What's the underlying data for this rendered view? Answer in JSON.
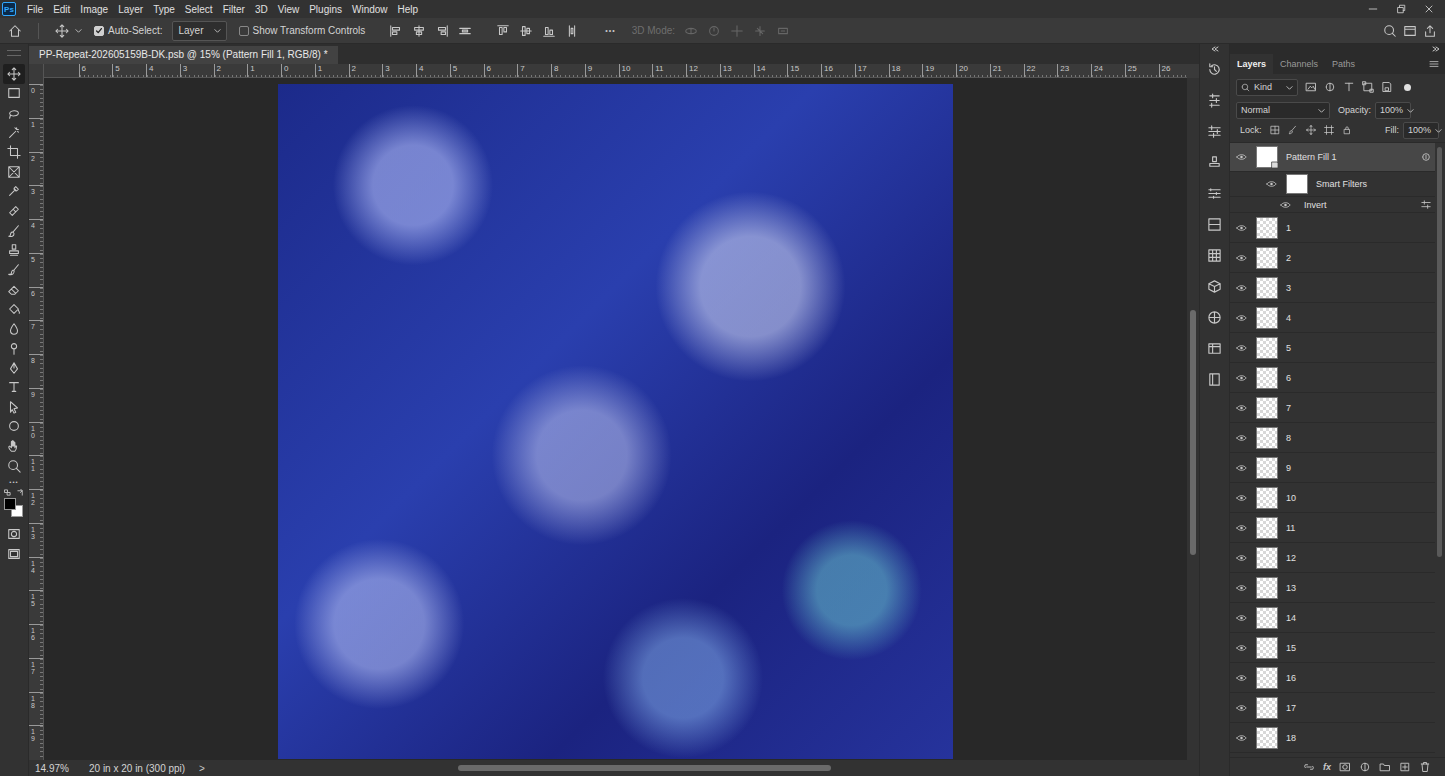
{
  "app": {
    "logo": "Ps"
  },
  "menu": [
    "File",
    "Edit",
    "Image",
    "Layer",
    "Type",
    "Select",
    "Filter",
    "3D",
    "View",
    "Plugins",
    "Window",
    "Help"
  ],
  "options_bar": {
    "auto_select": {
      "label": "Auto-Select:",
      "checked": true
    },
    "auto_select_target": "Layer",
    "show_transform_controls": {
      "label": "Show Transform Controls",
      "checked": false
    },
    "more": "•••",
    "mode_3d": {
      "label": "3D Mode:",
      "disabled": true
    }
  },
  "document": {
    "title": "PP-Repeat-202605159B-DK.psb @ 15% (Pattern Fill 1, RGB/8) *"
  },
  "rulers": {
    "horizontal": [
      "6",
      "5",
      "4",
      "3",
      "2",
      "1",
      "0",
      "1",
      "2",
      "3",
      "4",
      "5",
      "6",
      "7",
      "8",
      "9",
      "10",
      "11",
      "12",
      "13",
      "14",
      "15",
      "16",
      "17",
      "18",
      "19",
      "20",
      "21",
      "22",
      "23",
      "24",
      "25",
      "26"
    ],
    "vertical": [
      "0",
      "1",
      "2",
      "3",
      "4",
      "5",
      "6",
      "7",
      "8",
      "9",
      "10",
      "11",
      "12",
      "13",
      "14",
      "15",
      "16",
      "17",
      "18",
      "19"
    ]
  },
  "toolbar": {
    "tools": [
      {
        "selected": true
      },
      {
        "selected": false
      },
      {
        "selected": false
      },
      {
        "selected": false
      },
      {
        "selected": false
      },
      {
        "selected": false
      },
      {
        "selected": false
      },
      {
        "selected": false
      },
      {
        "selected": false
      },
      {
        "selected": false
      },
      {
        "selected": false
      },
      {
        "selected": false
      },
      {
        "selected": false
      },
      {
        "selected": false
      },
      {
        "selected": false
      },
      {
        "selected": false
      },
      {
        "selected": false
      },
      {
        "selected": false
      },
      {
        "selected": false
      },
      {
        "selected": false
      },
      {
        "selected": false
      }
    ],
    "more": "•••",
    "swatches": [
      {
        "role": "foreground",
        "color": "#000000"
      },
      {
        "role": "background",
        "color": "#ffffff"
      }
    ]
  },
  "status_bar": {
    "zoom": "14.97%",
    "info": "20 in x 20 in (300 ppi)",
    "arrow": ">"
  },
  "layers_panel": {
    "tabs": [
      {
        "label": "Layers",
        "selected": true
      },
      {
        "label": "Channels",
        "selected": false
      },
      {
        "label": "Paths",
        "selected": false
      }
    ],
    "filter": "Kind",
    "blend_mode": "Normal",
    "opacity_label": "Opacity:",
    "opacity": "100%",
    "lock_label": "Lock:",
    "fill_label": "Fill:",
    "fill": "100%",
    "layers": [
      {
        "name": "Pattern Fill 1",
        "kind": "smart-object",
        "visible": true,
        "selected": true
      },
      {
        "name": "Smart Filters",
        "kind": "smart-filters",
        "visible": true,
        "selected": false
      },
      {
        "name": "Invert",
        "kind": "filter",
        "visible": true,
        "selected": false
      },
      {
        "name": "1",
        "kind": "layer",
        "visible": true,
        "selected": false
      },
      {
        "name": "2",
        "kind": "layer",
        "visible": true,
        "selected": false
      },
      {
        "name": "3",
        "kind": "layer",
        "visible": true,
        "selected": false
      },
      {
        "name": "4",
        "kind": "layer",
        "visible": true,
        "selected": false
      },
      {
        "name": "5",
        "kind": "layer",
        "visible": true,
        "selected": false
      },
      {
        "name": "6",
        "kind": "layer",
        "visible": true,
        "selected": false
      },
      {
        "name": "7",
        "kind": "layer",
        "visible": true,
        "selected": false
      },
      {
        "name": "8",
        "kind": "layer",
        "visible": true,
        "selected": false
      },
      {
        "name": "9",
        "kind": "layer",
        "visible": true,
        "selected": false
      },
      {
        "name": "10",
        "kind": "layer",
        "visible": true,
        "selected": false
      },
      {
        "name": "11",
        "kind": "layer",
        "visible": true,
        "selected": false
      },
      {
        "name": "12",
        "kind": "layer",
        "visible": true,
        "selected": false
      },
      {
        "name": "13",
        "kind": "layer",
        "visible": true,
        "selected": false
      },
      {
        "name": "14",
        "kind": "layer",
        "visible": true,
        "selected": false
      },
      {
        "name": "15",
        "kind": "layer",
        "visible": true,
        "selected": false
      },
      {
        "name": "16",
        "kind": "layer",
        "visible": true,
        "selected": false
      },
      {
        "name": "17",
        "kind": "layer",
        "visible": true,
        "selected": false
      },
      {
        "name": "18",
        "kind": "layer",
        "visible": true,
        "selected": false
      }
    ],
    "footer_fx": "fx"
  }
}
